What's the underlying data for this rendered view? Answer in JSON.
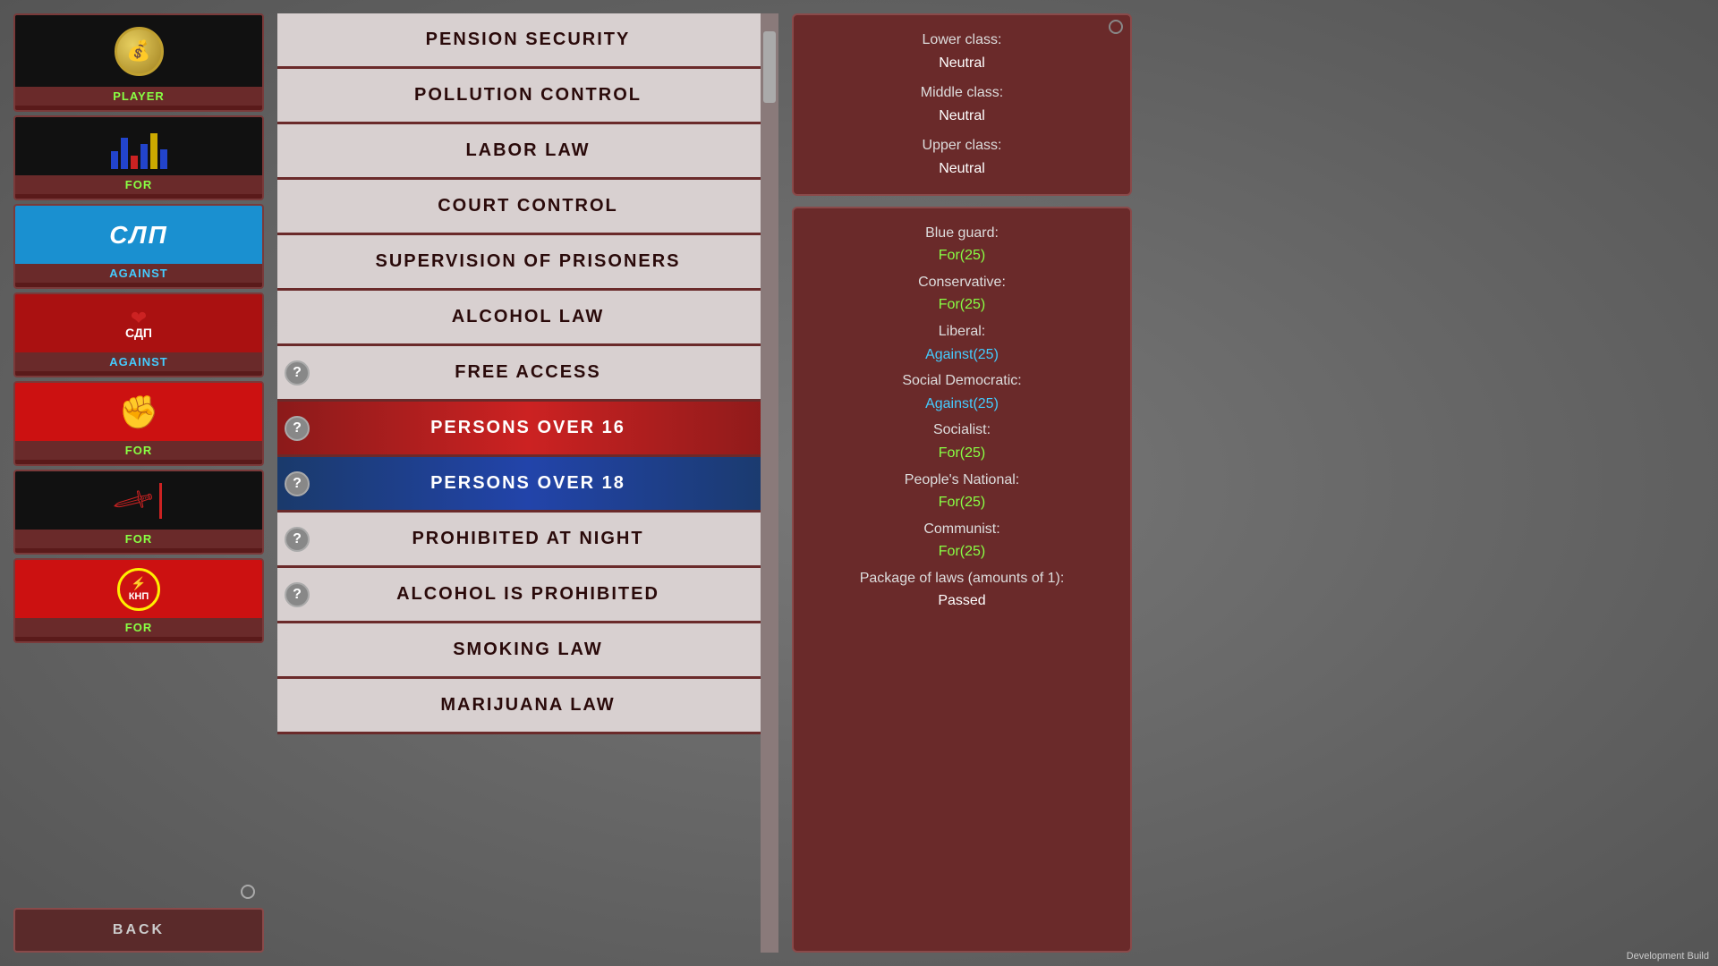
{
  "left": {
    "player_label": "PLAYER",
    "back_label": "BACK",
    "parties": [
      {
        "id": "blue-guard",
        "type": "building",
        "stance": "FOR",
        "stance_color": "for",
        "bg": "dark"
      },
      {
        "id": "liberal",
        "type": "slp",
        "text": "СЛП",
        "stance": "AGAINST",
        "stance_color": "against",
        "bg": "blue"
      },
      {
        "id": "social-democratic",
        "type": "sdp",
        "text": "СДП",
        "stance": "AGAINST",
        "stance_color": "against",
        "bg": "red"
      },
      {
        "id": "socialist",
        "type": "fist",
        "stance": "FOR",
        "stance_color": "for",
        "bg": "red"
      },
      {
        "id": "peoples-national",
        "type": "sword",
        "stance": "FOR",
        "stance_color": "for",
        "bg": "black"
      },
      {
        "id": "communist",
        "type": "knp",
        "text": "КНП",
        "stance": "FOR",
        "stance_color": "for",
        "bg": "red"
      }
    ]
  },
  "center": {
    "laws": [
      {
        "id": "pension-security",
        "label": "PENSION SECURITY",
        "has_question": false,
        "selected": null
      },
      {
        "id": "pollution-control",
        "label": "POLLUTION CONTROL",
        "has_question": false,
        "selected": null
      },
      {
        "id": "labor-law",
        "label": "LABOR LAW",
        "has_question": false,
        "selected": null
      },
      {
        "id": "court-control",
        "label": "COURT CONTROL",
        "has_question": false,
        "selected": null
      },
      {
        "id": "supervision-of-prisoners",
        "label": "SUPERVISION OF PRISONERS",
        "has_question": false,
        "selected": null
      },
      {
        "id": "alcohol-law",
        "label": "ALCOHOL LAW",
        "has_question": false,
        "selected": null
      },
      {
        "id": "free-access",
        "label": "FREE ACCESS",
        "has_question": true,
        "selected": null
      },
      {
        "id": "persons-over-16",
        "label": "PERSONS OVER 16",
        "has_question": true,
        "selected": "red"
      },
      {
        "id": "persons-over-18",
        "label": "PERSONS OVER 18",
        "has_question": true,
        "selected": "blue"
      },
      {
        "id": "prohibited-at-night",
        "label": "PROHIBITED AT NIGHT",
        "has_question": true,
        "selected": null
      },
      {
        "id": "alcohol-is-prohibited",
        "label": "ALCOHOL IS PROHIBITED",
        "has_question": true,
        "selected": null
      },
      {
        "id": "smoking-law",
        "label": "SMOKING LAW",
        "has_question": false,
        "selected": null
      },
      {
        "id": "marijuana-law",
        "label": "MARIJUANA LAW",
        "has_question": false,
        "selected": null
      }
    ]
  },
  "right_top": {
    "lower_class_label": "Lower class:",
    "lower_class_value": "Neutral",
    "middle_class_label": "Middle class:",
    "middle_class_value": "Neutral",
    "upper_class_label": "Upper class:",
    "upper_class_value": "Neutral"
  },
  "right_bottom": {
    "entries": [
      {
        "label": "Blue guard:",
        "value": "For(25)",
        "value_color": "green"
      },
      {
        "label": "Conservative:",
        "value": "For(25)",
        "value_color": "green"
      },
      {
        "label": "Liberal:",
        "value": "Against(25)",
        "value_color": "cyan"
      },
      {
        "label": "Social Democratic:",
        "value": "Against(25)",
        "value_color": "cyan"
      },
      {
        "label": "Socialist:",
        "value": "For(25)",
        "value_color": "green"
      },
      {
        "label": "People's National:",
        "value": "For(25)",
        "value_color": "green"
      },
      {
        "label": "Communist:",
        "value": "For(25)",
        "value_color": "green"
      },
      {
        "label": "Package of laws (amounts of 1):",
        "value": "Passed",
        "value_color": "white"
      }
    ]
  },
  "dev_build": "Development Build"
}
